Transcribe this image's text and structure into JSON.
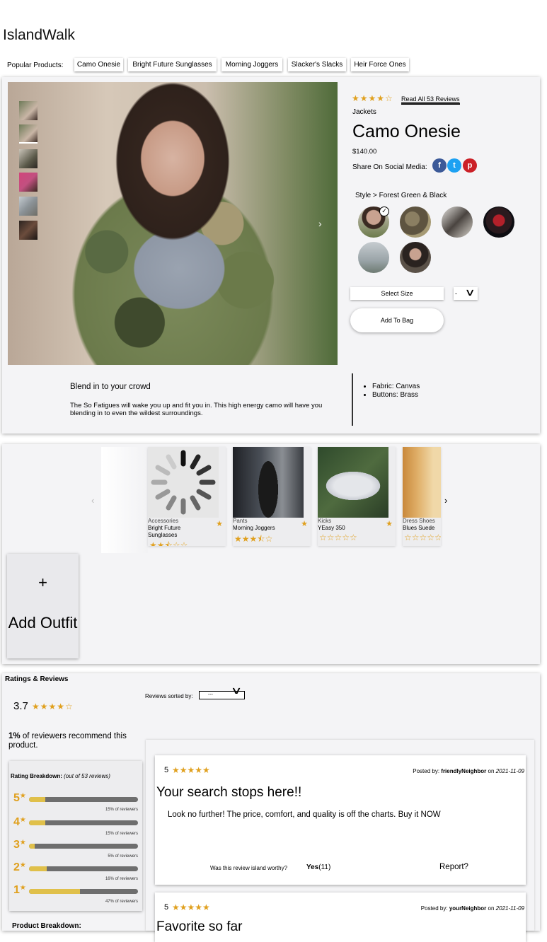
{
  "header": {
    "brand": "IslandWalk"
  },
  "popular": {
    "label": "Popular Products:",
    "items": [
      "Camo Onesie",
      "Bright Future Sunglasses",
      "Morning Joggers",
      "Slacker's Slacks",
      "Heir Force Ones"
    ]
  },
  "product": {
    "rating": 3.7,
    "stars_text": "★★★★☆",
    "read_reviews": "Read All 53 Reviews",
    "category": "Jackets",
    "name": "Camo Onesie",
    "price": "$140.00",
    "share_label": "Share On Social Media:",
    "social": [
      "f",
      "t",
      "p"
    ],
    "style_prefix": "Style >",
    "style_name": "Forest Green & Black",
    "select_size": "Select Size",
    "quantity": "-",
    "add_to_bag": "Add To Bag",
    "slogan": "Blend in to your crowd",
    "description": "The So Fatigues will wake you up and fit you in. This high energy camo will have you blending in to even the wildest surroundings.",
    "features": [
      "Fabric: Canvas",
      "Buttons: Brass"
    ]
  },
  "related": [
    {
      "category": "Accessories",
      "name": "Bright Future Sunglasses",
      "stars": "★★⯪☆☆",
      "rating": 2.5
    },
    {
      "category": "Pants",
      "name": "Morning Joggers",
      "stars": "★★★⯪☆",
      "rating": 3.5
    },
    {
      "category": "Kicks",
      "name": "YEasy 350",
      "stars": "☆☆☆☆☆",
      "rating": 0
    },
    {
      "category": "Dress Shoes",
      "name": "Blues Suede",
      "stars": "☆☆☆☆☆",
      "rating": 0
    }
  ],
  "outfit": {
    "plus": "+",
    "label": "Add Outfit"
  },
  "ratings": {
    "title": "Ratings & Reviews",
    "average": "3.7",
    "stars_text": "★★★★☆",
    "recommend_pct": "1%",
    "recommend_text": " of reviewers recommend this product.",
    "breakdown_title": "Rating Breakdown:",
    "breakdown_sub": "(out of 53 reviews)",
    "rows": [
      {
        "star": "5",
        "pct": 15,
        "label": "15% of reviewers"
      },
      {
        "star": "4",
        "pct": 15,
        "label": "15% of reviewers"
      },
      {
        "star": "3",
        "pct": 5,
        "label": "5% of reviewers"
      },
      {
        "star": "2",
        "pct": 16,
        "label": "16% of reviewers"
      },
      {
        "star": "1",
        "pct": 47,
        "label": "47% of reviewers"
      }
    ],
    "product_breakdown": "Product Breakdown:",
    "sorted_label": "Reviews sorted by:",
    "sorted_value": "---"
  },
  "reviews": [
    {
      "rating": "5",
      "stars": "★★★★★",
      "posted_by": "Posted by:",
      "user": "friendlyNeighbor",
      "on": "on",
      "date": "2021-11-09",
      "title": "Your search stops here!!",
      "body": "Look no further! The price, comfort, and quality is off the charts. Buy it NOW",
      "helpful": "Was this review island worthy?",
      "yes": "Yes",
      "yes_count": "(11)",
      "report": "Report?"
    },
    {
      "rating": "5",
      "stars": "★★★★★",
      "posted_by": "Posted by:",
      "user": "yourNeighbor",
      "on": "on",
      "date": "2021-11-09",
      "title": "Favorite so far"
    }
  ]
}
